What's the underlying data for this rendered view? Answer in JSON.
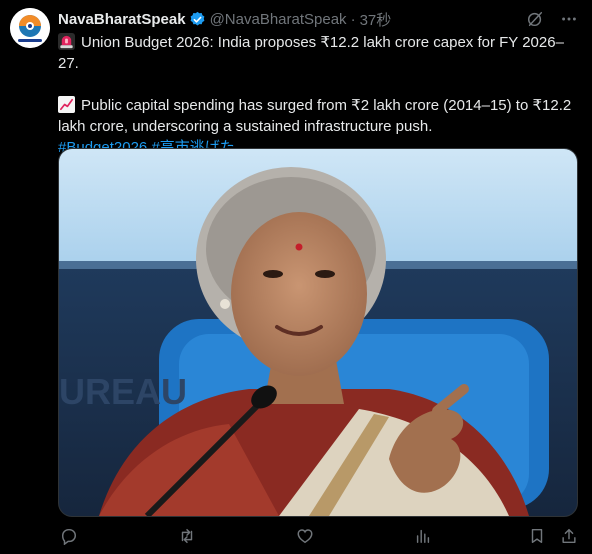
{
  "post": {
    "author_name": "NavaBharatSpeak",
    "handle": "@NavaBharatSpeak",
    "separator": "·",
    "time": "37秒",
    "line1": "Union Budget 2026: India proposes ₹12.2 lakh crore capex for FY 2026–27.",
    "line2a": "Public capital spending has surged from ₹2 lakh crore (2014–15) to ₹12.2",
    "line2b": "lakh crore, underscoring a sustained infrastructure push.",
    "hashtags": [
      "#Budget2026",
      "#高市逃げた"
    ]
  },
  "icons": {
    "verified": "verified-badge-icon",
    "grok": "grok-icon",
    "more": "more-icon",
    "siren": "siren-emoji",
    "chart": "chart-increasing-emoji",
    "reply": "reply-icon",
    "repost": "repost-icon",
    "like": "like-icon",
    "views": "views-icon",
    "bookmark": "bookmark-icon",
    "share": "share-icon"
  },
  "colors": {
    "background": "#000000",
    "text": "#e7e9ea",
    "muted": "#71767b",
    "accent": "#1d9bf0"
  }
}
